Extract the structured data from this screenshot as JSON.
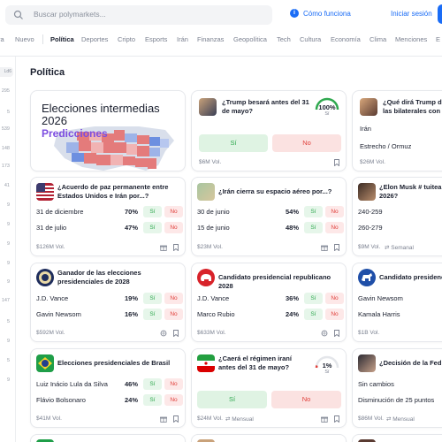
{
  "search": {
    "placeholder": "Buscar polymarkets..."
  },
  "header": {
    "how_it_works": "Cómo funciona",
    "login": "Iniciar sesión"
  },
  "categories": [
    "ra",
    "Nuevo",
    "Política",
    "Deportes",
    "Cripto",
    "Esports",
    "Irán",
    "Finanzas",
    "Geopolítica",
    "Tech",
    "Cultura",
    "Economía",
    "Clima",
    "Menciones",
    "E"
  ],
  "active_category": "Política",
  "sidebar": {
    "chip": "Ld6",
    "numbers": [
      "295",
      "5",
      "539",
      "148",
      "173",
      "41",
      "9",
      "9",
      "9",
      "9",
      "9",
      "147",
      "5",
      "9",
      "5",
      "9"
    ]
  },
  "section_title": "Política",
  "cards": {
    "midterms": {
      "title_line1": "Elecciones intermedias",
      "title_line2": "2026",
      "subtitle": "Predicciones"
    },
    "trump31": {
      "title": "¿Trump besará antes del 31 de mayo?",
      "pct": "100%",
      "pct_label": "Sí",
      "si": "Sí",
      "no": "No",
      "vol": "$6M Vol."
    },
    "trump_xi": {
      "title": "¿Qué dirá Trump durante las bilaterales con Xi Jin",
      "row1": "Irán",
      "row2": "Estrecho / Ormuz",
      "vol": "$26M Vol."
    },
    "paz": {
      "title": "¿Acuerdo de paz permanente entre Estados Unidos e Irán por...?",
      "rows": [
        {
          "label": "31 de diciembre",
          "pct": "70%"
        },
        {
          "label": "31 de julio",
          "pct": "47%"
        }
      ],
      "si": "Sí",
      "no": "No",
      "vol": "$126M Vol."
    },
    "espacio": {
      "title": "¿Irán cierra su espacio aéreo por...?",
      "rows": [
        {
          "label": "30 de junio",
          "pct": "54%"
        },
        {
          "label": "15 de junio",
          "pct": "48%"
        }
      ],
      "si": "Sí",
      "no": "No",
      "vol": "$23M Vol."
    },
    "musk": {
      "title": "¿Elon Musk # tuitea de 2026?",
      "rows": [
        {
          "label": "240-259"
        },
        {
          "label": "260-279"
        }
      ],
      "vol": "$9M Vol.",
      "freq": "Semanal"
    },
    "ganador": {
      "title": "Ganador de las elecciones presidenciales de 2028",
      "rows": [
        {
          "label": "J.D. Vance",
          "pct": "19%"
        },
        {
          "label": "Gavin Newsom",
          "pct": "16%"
        }
      ],
      "si": "Sí",
      "no": "No",
      "vol": "$592M Vol."
    },
    "republicano": {
      "title": "Candidato presidencial republicano 2028",
      "rows": [
        {
          "label": "J.D. Vance",
          "pct": "36%"
        },
        {
          "label": "Marco Rubio",
          "pct": "24%"
        }
      ],
      "si": "Sí",
      "no": "No",
      "vol": "$633M Vol."
    },
    "demo": {
      "title": "Candidato presidencial",
      "rows": [
        {
          "label": "Gavin Newsom"
        },
        {
          "label": "Kamala Harris"
        }
      ],
      "vol": "$1B Vol."
    },
    "brasil": {
      "title": "Elecciones presidenciales de Brasil",
      "rows": [
        {
          "label": "Luiz Inácio Lula da Silva",
          "pct": "46%"
        },
        {
          "label": "Flávio Bolsonaro",
          "pct": "24%"
        }
      ],
      "si": "Sí",
      "no": "No",
      "vol": "$41M Vol."
    },
    "regimen": {
      "title": "¿Caerá el régimen iraní antes del 31 de mayo?",
      "pct": "1%",
      "pct_label": "Sí",
      "si": "Sí",
      "no": "No",
      "vol": "$24M Vol.",
      "freq": "Mensual"
    },
    "fed": {
      "title": "¿Decisión de la Fed e",
      "rows": [
        {
          "label": "Sin cambios"
        },
        {
          "label": "Disminución de 25 puntos"
        }
      ],
      "vol": "$86M Vol.",
      "freq": "Mensual"
    }
  },
  "colors": {
    "accent": "#1a6cf6",
    "yes_bg": "#e6f6ea",
    "yes_text": "#2fa84f",
    "no_bg": "#fde8e8",
    "no_text": "#e0413c"
  }
}
